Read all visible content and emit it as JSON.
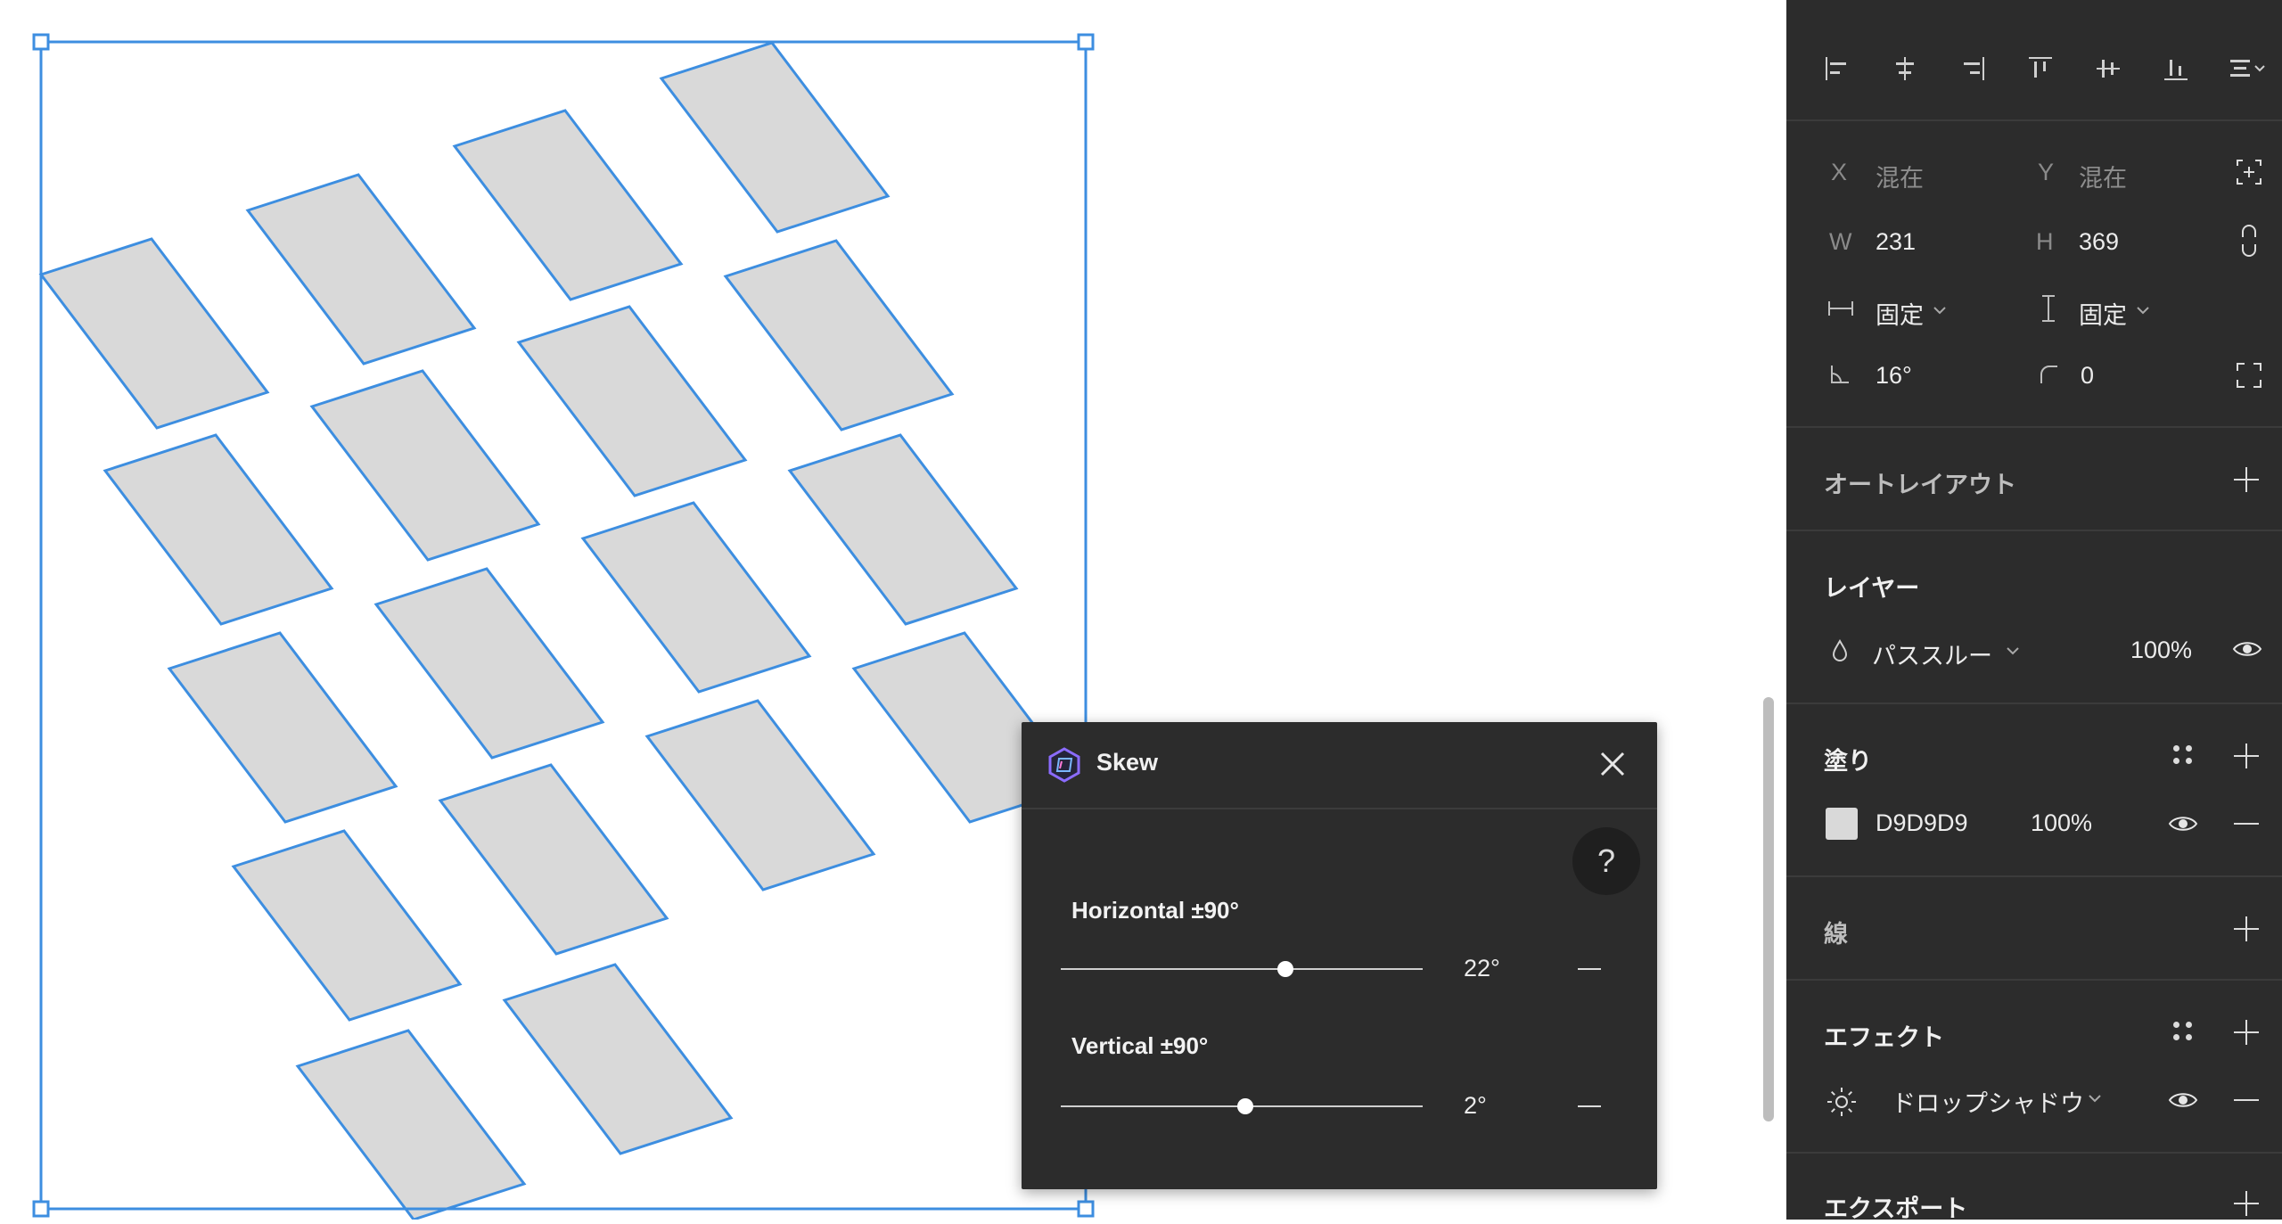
{
  "canvas": {
    "selection_color": "#3d8ee0",
    "shape_fill": "#d9d9d9"
  },
  "panel": {
    "x_label": "X",
    "x_value": "混在",
    "y_label": "Y",
    "y_value": "混在",
    "w_label": "W",
    "w_value": "231",
    "h_label": "H",
    "h_value": "369",
    "width_mode": "固定",
    "height_mode": "固定",
    "rotation": "16°",
    "corner_radius": "0",
    "auto_layout_title": "オートレイアウト",
    "layer_title": "レイヤー",
    "blend_mode": "パススルー",
    "layer_opacity": "100%",
    "fill_title": "塗り",
    "fill_hex": "D9D9D9",
    "fill_opacity": "100%",
    "fill_color": "#d9d9d9",
    "stroke_title": "線",
    "effects_title": "エフェクト",
    "effect_name": "ドロップシャドウ",
    "export_title": "エクスポート"
  },
  "skew_dialog": {
    "title": "Skew",
    "help_label": "?",
    "horizontal_label": "Horizontal ±90°",
    "horizontal_value": "22°",
    "horizontal_level": 0.62,
    "vertical_label": "Vertical ±90°",
    "vertical_value": "2°",
    "vertical_level": 0.51
  }
}
